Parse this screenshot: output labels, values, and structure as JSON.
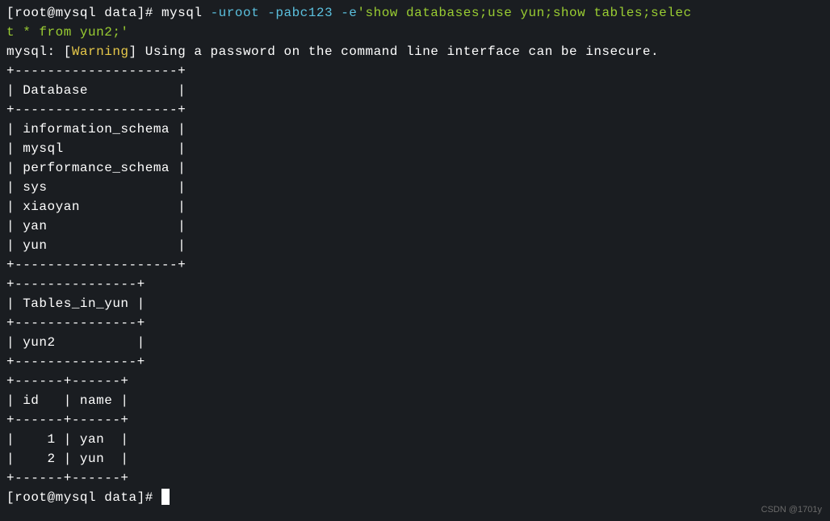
{
  "prompt1": {
    "open": "[",
    "userhost": "root@mysql data",
    "close": "]# ",
    "cmd": "mysql ",
    "args1": "-uroot -pabc123 -e",
    "query1": "'show databases;use yun;show tables;selec",
    "query2": "t * from yun2;'"
  },
  "warning_line": {
    "prefix": "mysql: [",
    "warning": "Warning",
    "suffix": "] Using a password on the command line interface can be insecure."
  },
  "table1": {
    "border_top": "+--------------------+",
    "header": "| Database           |",
    "border_mid": "+--------------------+",
    "rows": [
      "| information_schema |",
      "| mysql              |",
      "| performance_schema |",
      "| sys                |",
      "| xiaoyan            |",
      "| yan                |",
      "| yun                |"
    ],
    "border_bot": "+--------------------+"
  },
  "table2": {
    "border_top": "+---------------+",
    "header": "| Tables_in_yun |",
    "border_mid": "+---------------+",
    "rows": [
      "| yun2          |"
    ],
    "border_bot": "+---------------+"
  },
  "table3": {
    "border_top": "+------+------+",
    "header": "| id   | name |",
    "border_mid": "+------+------+",
    "rows": [
      "|    1 | yan  |",
      "|    2 | yun  |"
    ],
    "border_bot": "+------+------+"
  },
  "prompt2": {
    "open": "[",
    "userhost": "root@mysql data",
    "close": "]# "
  },
  "watermark": "CSDN @1701y"
}
